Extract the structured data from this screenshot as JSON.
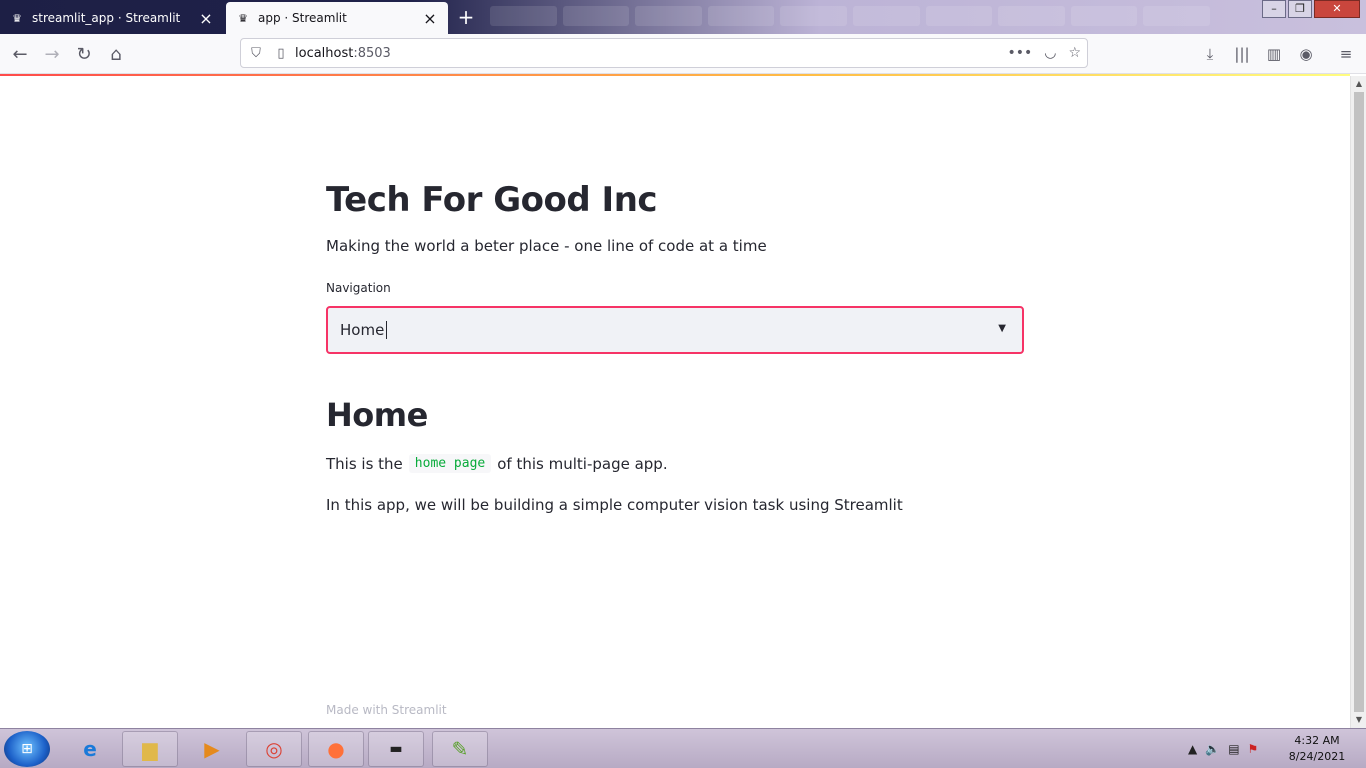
{
  "browser": {
    "tabs": [
      {
        "title": "streamlit_app · Streamlit",
        "active": false
      },
      {
        "title": "app · Streamlit",
        "active": true
      }
    ],
    "url_host": "localhost",
    "url_port": ":8503",
    "new_tab_label": "+"
  },
  "app": {
    "title": "Tech For Good Inc",
    "subtitle": "Making the world a beter place - one line of code at a time",
    "nav_label": "Navigation",
    "nav_selected": "Home",
    "page_heading": "Home",
    "para1_before": "This is the",
    "para1_code": "home page",
    "para1_after": "of this multi-page app.",
    "para2": "In this app, we will be building a simple computer vision task using Streamlit",
    "footer": "Made with Streamlit",
    "accent_color": "#f63366",
    "code_color": "#09ab3b"
  },
  "taskbar": {
    "time": "4:32 AM",
    "date": "8/24/2021"
  }
}
